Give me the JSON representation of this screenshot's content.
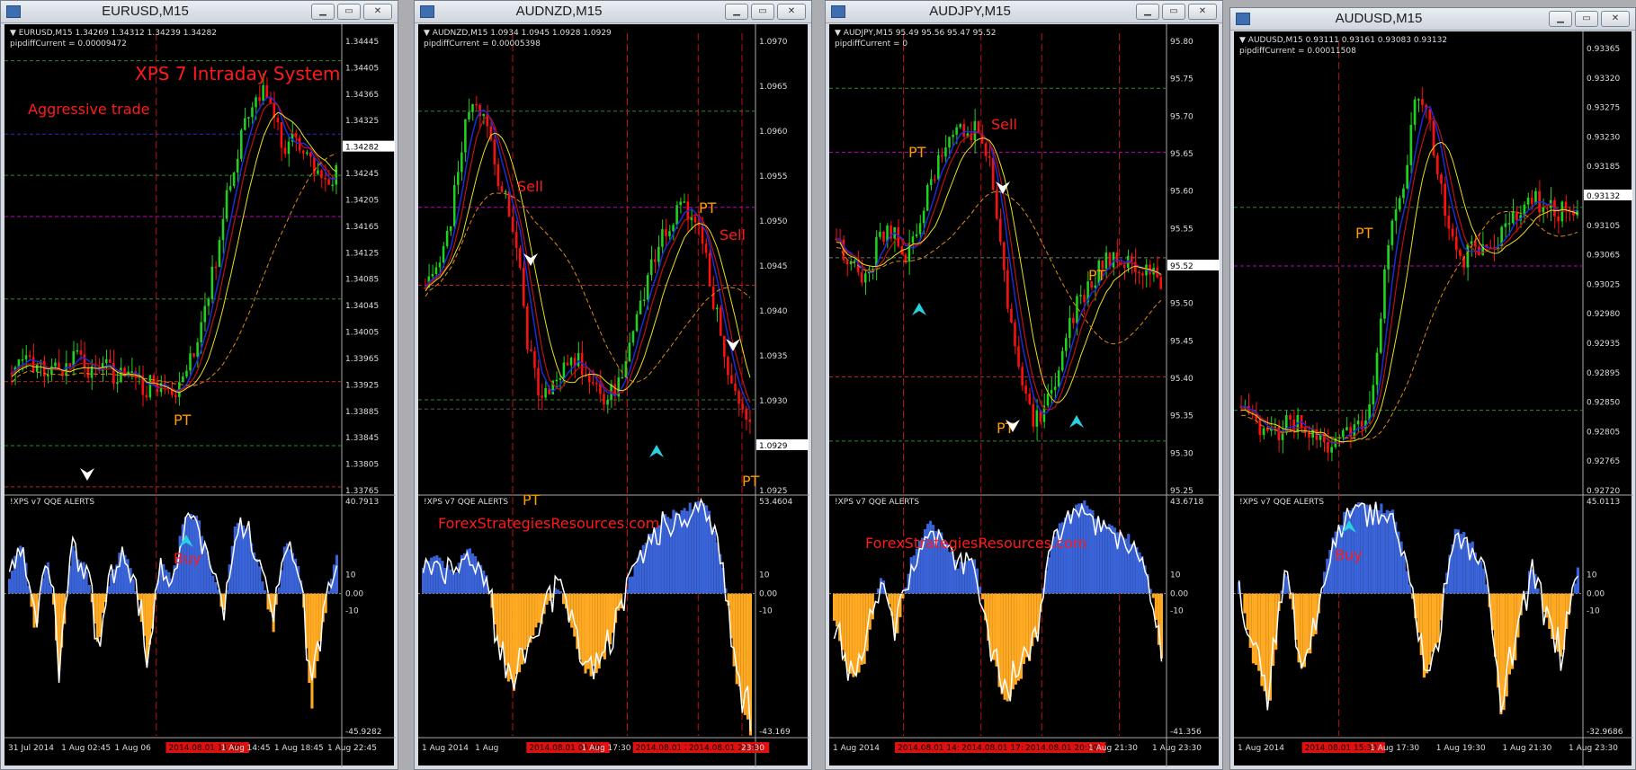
{
  "windows": [
    {
      "title": "EURUSD,M15",
      "symbol_line": "EURUSD,M15  1.34269 1.34312 1.34239 1.34282",
      "pipdiff": "pipdiffCurrent = 0.00009472",
      "price_labels": [
        "1.34445",
        "1.34405",
        "1.34365",
        "1.34325",
        "1.34282",
        "1.34245",
        "1.34205",
        "1.34165",
        "1.34125",
        "1.34085",
        "1.34045",
        "1.34005",
        "1.33965",
        "1.33925",
        "1.33885",
        "1.33845",
        "1.33805",
        "1.33765"
      ],
      "current_price": "1.34282",
      "annotations": [
        "XPS 7 Intraday System",
        "Aggressive  trade",
        "PT",
        "Buy"
      ],
      "indicator_label": "!XPS v7 QQE ALERTS",
      "indicator_scale": [
        "40.7913",
        "10",
        "0.00",
        "-10",
        "-45.9282"
      ],
      "time_labels": [
        "31 Jul 2014",
        "1 Aug 02:45",
        "1 Aug 06",
        "2014.08.01 11:30",
        "1 Aug 14:45",
        "1 Aug 18:45",
        "1 Aug 22:45"
      ],
      "highlight_time_index": 3
    },
    {
      "title": "AUDNZD,M15",
      "symbol_line": "AUDNZD,M15  1.0934 1.0945 1.0928 1.0929",
      "pipdiff": "pipdiffCurrent = 0.00005398",
      "price_labels": [
        "1.0970",
        "1.0965",
        "1.0960",
        "1.0955",
        "1.0950",
        "1.0945",
        "1.0940",
        "1.0935",
        "1.0930",
        "1.0929",
        "1.0925"
      ],
      "current_price": "1.0929",
      "annotations": [
        "Sell",
        "PT",
        "Sell",
        "PT",
        "PT",
        "ForexStrategiesResources.com"
      ],
      "indicator_label": "!XPS v7 QQE ALERTS",
      "indicator_scale": [
        "53.4604",
        "10",
        "0.00",
        "-10",
        "-43.169"
      ],
      "time_labels": [
        "1 Aug 2014",
        "1 Aug",
        "2014.08.01 05:30",
        "1 Aug 17:30",
        "2014.08.01 20:30",
        "2014.08.01 23:30",
        "23:30"
      ],
      "highlight_time_indexes": [
        2,
        4,
        5
      ]
    },
    {
      "title": "AUDJPY,M15",
      "symbol_line": "AUDJPY,M15  95.49 95.56 95.47 95.52",
      "pipdiff": "pipdiffCurrent = 0",
      "price_labels": [
        "95.80",
        "95.75",
        "95.70",
        "95.65",
        "95.60",
        "95.55",
        "95.52",
        "95.50",
        "95.45",
        "95.40",
        "95.35",
        "95.30",
        "95.25"
      ],
      "current_price": "95.52",
      "annotations": [
        "PT",
        "Sell",
        "PT",
        "PT",
        "ForexStrategiesResources.com"
      ],
      "indicator_label": "!XPS v7 QQE ALERTS",
      "indicator_scale": [
        "43.6718",
        "10",
        "0.00",
        "-10",
        "-41.356"
      ],
      "time_labels": [
        "1 Aug 2014",
        "2014.08.01 14:45",
        "2014.08.01 17:45",
        "2014.08.01 20:30",
        "1 Aug 21:30",
        "1 Aug 23:30"
      ],
      "highlight_time_indexes": [
        1,
        2,
        3
      ]
    },
    {
      "title": "AUDUSD,M15",
      "symbol_line": "AUDUSD,M15  0.93111 0.93161 0.93083 0.93132",
      "pipdiff": "pipdiffCurrent = 0.00011508",
      "price_labels": [
        "0.93365",
        "0.93320",
        "0.93275",
        "0.93230",
        "0.93185",
        "0.93132",
        "0.93105",
        "0.93065",
        "0.93025",
        "0.92980",
        "0.92935",
        "0.92895",
        "0.92850",
        "0.92805",
        "0.92765",
        "0.92720"
      ],
      "current_price": "0.93132",
      "annotations": [
        "PT",
        "Buy"
      ],
      "indicator_label": "!XPS v7 QQE ALERTS",
      "indicator_scale": [
        "45.0113",
        "10",
        "0.00",
        "-10",
        "-32.9686"
      ],
      "time_labels": [
        "1 Aug 2014",
        "2014.08.01 15:30",
        "1 Aug 17:30",
        "1 Aug 19:30",
        "1 Aug 21:30",
        "1 Aug 23:30"
      ],
      "highlight_time_index": 1
    }
  ],
  "colors": {
    "chart_bg": "#000000",
    "bull_candle": "#1fd21f",
    "bear_candle": "#ff1010",
    "annotation_red": "#ff1a1a",
    "annotation_orange": "#ff9a00",
    "qqe_blue": "#3a63d8",
    "qqe_orange": "#ffaa22",
    "purple_line": "#c000c0"
  }
}
